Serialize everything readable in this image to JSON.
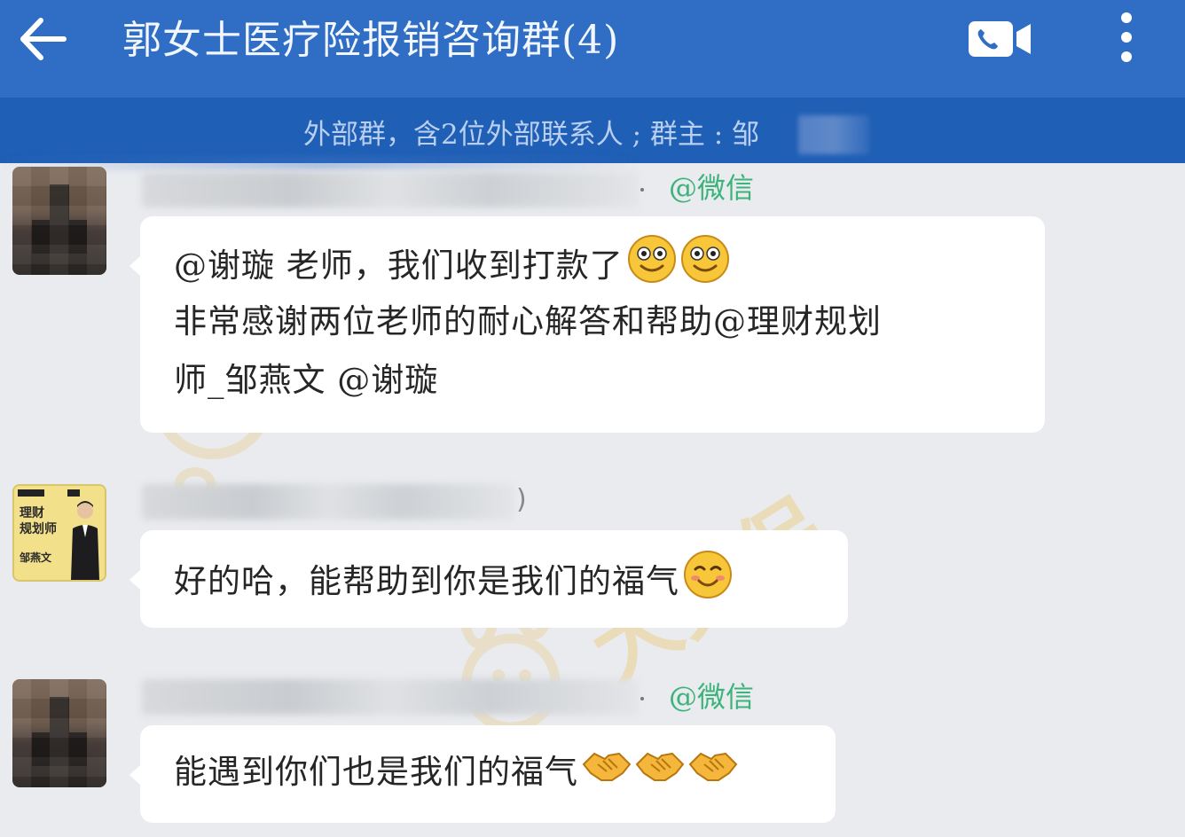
{
  "header": {
    "title": "郭女士医疗险报销咨询群(4)",
    "back_icon": "arrow-left-icon",
    "video_icon": "video-call-icon",
    "more_icon": "more-vertical-icon"
  },
  "group_info": {
    "text": "外部群，含2位外部联系人 ; 群主 : 邹"
  },
  "colors": {
    "header_bg": "#2f6ec4",
    "subheader_bg": "#1f5fb5",
    "chat_bg": "#e9ebee",
    "wechat_tag": "#3bb37a"
  },
  "messages": [
    {
      "sender_tag": "@微信",
      "lines": [
        "@谢璇 老师，我们收到打款了",
        "非常感谢两位老师的耐心解答和帮助@理财规划",
        "师_邹燕文 @谢璇"
      ],
      "emojis": [
        "smile-emoji",
        "smile-emoji"
      ]
    },
    {
      "sender_paren": ")",
      "avatar_text": "理财\n规划师",
      "avatar_name": "邹燕文",
      "text": "好的哈，能帮助到你是我们的福气",
      "emojis": [
        "blush-emoji"
      ]
    },
    {
      "sender_tag": "@微信",
      "text": "能遇到你们也是我们的福气",
      "emojis": [
        "handshake-emoji",
        "handshake-emoji",
        "handshake-emoji"
      ]
    }
  ],
  "watermark": {
    "text": "大兔保"
  }
}
